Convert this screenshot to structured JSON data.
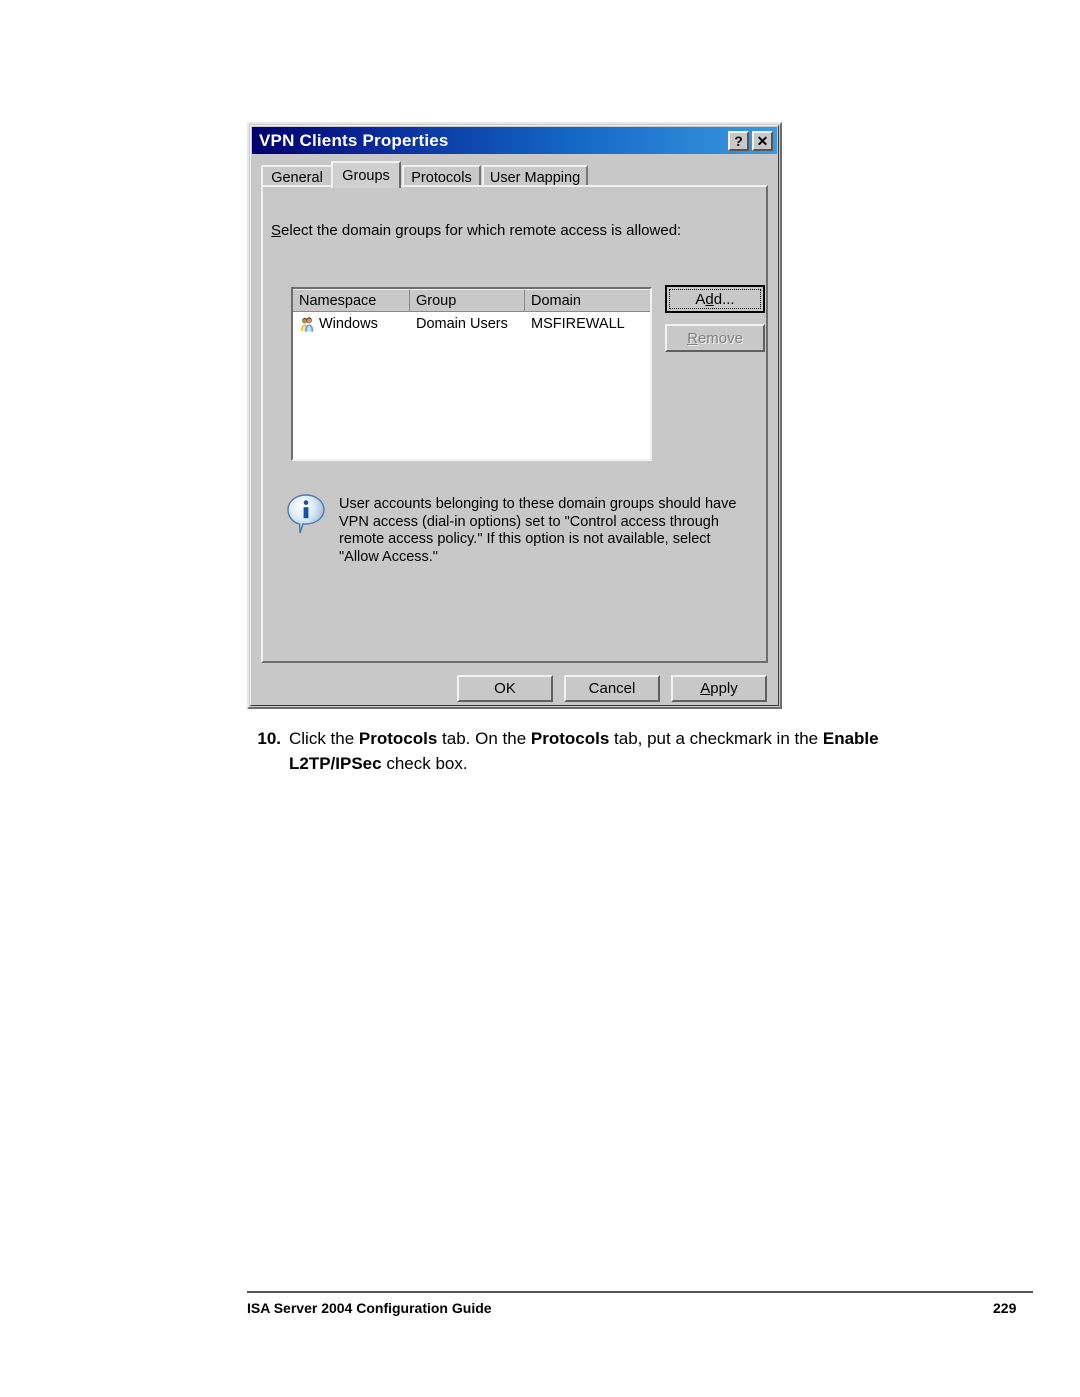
{
  "document": {
    "footer": {
      "title": "ISA Server 2004 Configuration Guide",
      "page_number": "229"
    },
    "step": {
      "number": "10.",
      "text_1": "Click the ",
      "bold_1": "Protocols",
      "text_2": " tab. On the ",
      "bold_2": "Protocols",
      "text_3": " tab, put a checkmark in the ",
      "bold_3": "Enable L2TP/IPSec",
      "text_4": " check box."
    }
  },
  "dialog": {
    "title": "VPN Clients Properties",
    "titlebar_buttons": {
      "help": "?",
      "close": "✕"
    },
    "tabs": [
      {
        "label": "General",
        "active": false
      },
      {
        "label": "Groups",
        "active": true
      },
      {
        "label": "Protocols",
        "active": false
      },
      {
        "label": "User Mapping",
        "active": false
      }
    ],
    "prompt_label": {
      "accel": "S",
      "rest": "elect the domain groups for which remote access is allowed:"
    },
    "listview": {
      "columns": [
        "Namespace",
        "Group",
        "Domain"
      ],
      "rows": [
        {
          "icon": "users-icon",
          "namespace": "Windows",
          "group": "Domain Users",
          "domain": "MSFIREWALL"
        }
      ]
    },
    "side_buttons": {
      "add": {
        "pre": "A",
        "accel": "d",
        "post": "d...",
        "enabled": true,
        "focused": true
      },
      "remove": {
        "accel": "R",
        "post": "emove",
        "enabled": false
      }
    },
    "info": {
      "icon": "info-icon",
      "text": "User accounts belonging to these domain groups should have VPN access (dial-in options) set to \"Control access through remote access policy.\" If this option is not available, select \"Allow Access.\""
    },
    "footer_buttons": {
      "ok": "OK",
      "cancel": "Cancel",
      "apply_accel": "A",
      "apply_rest": "pply"
    }
  },
  "colors": {
    "dialog_face": "#c8c8c8",
    "titlebar_start": "#00006e",
    "titlebar_end": "#3b9ae1",
    "listview_bg": "#ffffff",
    "disabled_text": "#808080"
  }
}
